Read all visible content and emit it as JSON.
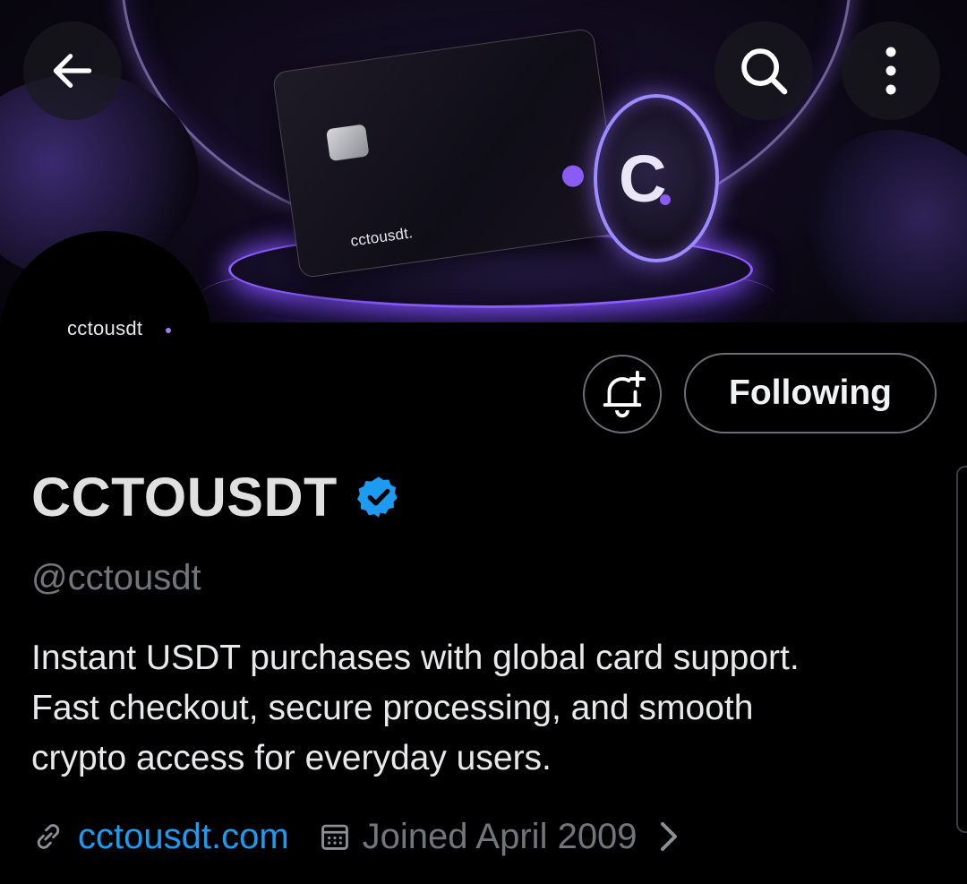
{
  "banner": {
    "card_brand": "cctousdt.",
    "coin_letter": "C",
    "accent_color": "#8a5cf5"
  },
  "header": {
    "back_icon": "arrow-left-icon",
    "search_icon": "search-icon",
    "more_icon": "more-vertical-icon"
  },
  "avatar": {
    "text": "cctousdt"
  },
  "actions": {
    "notify_icon": "bell-plus-icon",
    "follow_label": "Following"
  },
  "profile": {
    "display_name": "CCTOUSDT",
    "verified": true,
    "verified_color": "#1d9bf0",
    "handle": "@cctousdt",
    "bio_lines": [
      "Instant USDT purchases with global card support.",
      "Fast checkout, secure processing, and smooth",
      "crypto access for everyday users."
    ],
    "website": "cctousdt.com",
    "joined": "Joined April 2009",
    "link_color": "#1d9bf0"
  }
}
